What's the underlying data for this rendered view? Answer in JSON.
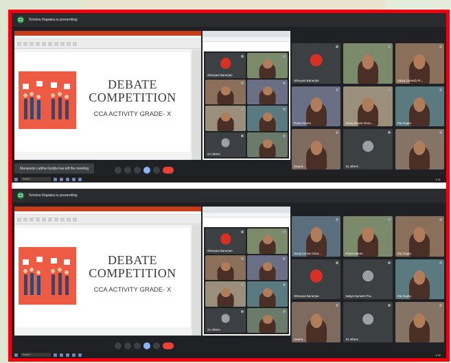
{
  "screens": [
    {
      "presenter_banner": "Srirsha Rapaka is presenting",
      "slide": {
        "title_line1": "DEBATE",
        "title_line2": "COMPETITION",
        "subtitle": "CCA ACTIVITY GRADE- X"
      },
      "toast": "Manasvini Lalitha Gedda has left the meeting",
      "mini_tiles": [
        {
          "name": "Shreyasi Banerjee",
          "kind": "avatar"
        },
        {
          "name": "",
          "kind": "video"
        },
        {
          "name": "",
          "kind": "video"
        },
        {
          "name": "",
          "kind": "video"
        },
        {
          "name": "",
          "kind": "video"
        },
        {
          "name": "",
          "kind": "video"
        },
        {
          "name": "24 others",
          "kind": "others"
        },
        {
          "name": "",
          "kind": "video"
        }
      ],
      "tiles": [
        {
          "name": "Shreyasi Banerjee",
          "kind": "avatar"
        },
        {
          "name": "",
          "kind": "video"
        },
        {
          "name": "Satya Ganesh Pr...",
          "kind": "video"
        },
        {
          "name": "Pranv Naren",
          "kind": "video"
        },
        {
          "name": "Suraj Kumar Gera...",
          "kind": "video"
        },
        {
          "name": "Ria Gupta",
          "kind": "video"
        },
        {
          "name": "Osaria...",
          "kind": "video"
        },
        {
          "name": "24 others",
          "kind": "others"
        },
        {
          "name": "",
          "kind": "video"
        }
      ],
      "taskbar_search": "Search",
      "clock": "1:31"
    },
    {
      "presenter_banner": "Srirsha Rapaka is presenting",
      "slide": {
        "title_line1": "DEBATE",
        "title_line2": "COMPETITION",
        "subtitle": "CCA ACTIVITY GRADE- X"
      },
      "toast": "",
      "mini_tiles": [
        {
          "name": "Shreyasi Banerjee",
          "kind": "avatar"
        },
        {
          "name": "",
          "kind": "video"
        },
        {
          "name": "",
          "kind": "video"
        },
        {
          "name": "",
          "kind": "video"
        },
        {
          "name": "",
          "kind": "video"
        },
        {
          "name": "",
          "kind": "video"
        },
        {
          "name": "24 others",
          "kind": "others"
        },
        {
          "name": "",
          "kind": "video"
        }
      ],
      "tiles": [
        {
          "name": "Suraj Kumar Gera...",
          "kind": "video"
        },
        {
          "name": "Pranv Naren",
          "kind": "video"
        },
        {
          "name": "Ria Gupta",
          "kind": "video"
        },
        {
          "name": "Shreyasi Banerjee",
          "kind": "avatar"
        },
        {
          "name": "Satya Ganesh Pra...",
          "kind": "others-icon"
        },
        {
          "name": "Ria Gupta",
          "kind": "video"
        },
        {
          "name": "Osaria...",
          "kind": "video"
        },
        {
          "name": "23 others",
          "kind": "others"
        },
        {
          "name": "",
          "kind": "video"
        }
      ],
      "taskbar_search": "Search",
      "clock": "1:32"
    }
  ],
  "colors": {
    "frame": "#f2000e",
    "meet_bg": "#202124",
    "slide_accent": "#ed5b45",
    "avatar_red": "#d93025",
    "present_green": "#1e8e3e"
  }
}
